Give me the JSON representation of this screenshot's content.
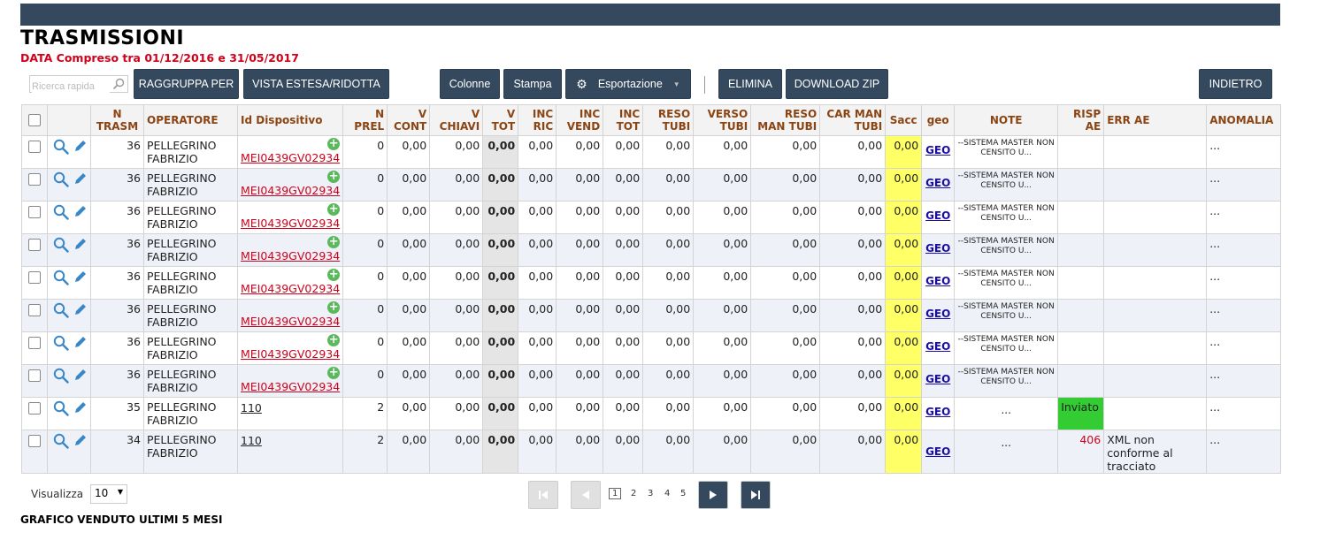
{
  "page": {
    "title": "TRASMISSIONI",
    "subtitle": "DATA Compreso tra 01/12/2016 e 31/05/2017"
  },
  "toolbar": {
    "search_placeholder": "Ricerca rapida",
    "raggruppa": "RAGGRUPPA PER",
    "vista": "VISTA ESTESA/RIDOTTA",
    "colonne": "Colonne",
    "stampa": "Stampa",
    "esportazione": "Esportazione",
    "elimina": "ELIMINA",
    "download": "DOWNLOAD ZIP",
    "indietro": "INDIETRO"
  },
  "table": {
    "headers": [
      "",
      "",
      "N TRASM",
      "OPERATORE",
      "Id Dispositivo",
      "N PREL",
      "V CONT",
      "V CHIAVI",
      "V TOT",
      "INC RIC",
      "INC VEND",
      "INC TOT",
      "RESO TUBI",
      "VERSO TUBI",
      "RESO MAN TUBI",
      "CAR MAN TUBI",
      "Sacc",
      "geo",
      "NOTE",
      "RISP AE",
      "ERR AE",
      "ANOMALIA"
    ],
    "rows": [
      {
        "trasm": "36",
        "operatore": "PELLEGRINO FABRIZIO",
        "dispositivo": "MEI0439GV02934",
        "prel": "0",
        "cont": "0,00",
        "chiavi": "0,00",
        "tot": "0,00",
        "incric": "0,00",
        "incvend": "0,00",
        "inctot": "0,00",
        "reso": "0,00",
        "verso": "0,00",
        "resoman": "0,00",
        "carman": "0,00",
        "sacc": "0,00",
        "geo": "GEO",
        "note": "--SISTEMA MASTER NON CENSITO U...",
        "risp": "",
        "err": "",
        "anomalia": "..."
      },
      {
        "trasm": "36",
        "operatore": "PELLEGRINO FABRIZIO",
        "dispositivo": "MEI0439GV02934",
        "prel": "0",
        "cont": "0,00",
        "chiavi": "0,00",
        "tot": "0,00",
        "incric": "0,00",
        "incvend": "0,00",
        "inctot": "0,00",
        "reso": "0,00",
        "verso": "0,00",
        "resoman": "0,00",
        "carman": "0,00",
        "sacc": "0,00",
        "geo": "GEO",
        "note": "--SISTEMA MASTER NON CENSITO U...",
        "risp": "",
        "err": "",
        "anomalia": "..."
      },
      {
        "trasm": "36",
        "operatore": "PELLEGRINO FABRIZIO",
        "dispositivo": "MEI0439GV02934",
        "prel": "0",
        "cont": "0,00",
        "chiavi": "0,00",
        "tot": "0,00",
        "incric": "0,00",
        "incvend": "0,00",
        "inctot": "0,00",
        "reso": "0,00",
        "verso": "0,00",
        "resoman": "0,00",
        "carman": "0,00",
        "sacc": "0,00",
        "geo": "GEO",
        "note": "--SISTEMA MASTER NON CENSITO U...",
        "risp": "",
        "err": "",
        "anomalia": "..."
      },
      {
        "trasm": "36",
        "operatore": "PELLEGRINO FABRIZIO",
        "dispositivo": "MEI0439GV02934",
        "prel": "0",
        "cont": "0,00",
        "chiavi": "0,00",
        "tot": "0,00",
        "incric": "0,00",
        "incvend": "0,00",
        "inctot": "0,00",
        "reso": "0,00",
        "verso": "0,00",
        "resoman": "0,00",
        "carman": "0,00",
        "sacc": "0,00",
        "geo": "GEO",
        "note": "--SISTEMA MASTER NON CENSITO U...",
        "risp": "",
        "err": "",
        "anomalia": "..."
      },
      {
        "trasm": "36",
        "operatore": "PELLEGRINO FABRIZIO",
        "dispositivo": "MEI0439GV02934",
        "prel": "0",
        "cont": "0,00",
        "chiavi": "0,00",
        "tot": "0,00",
        "incric": "0,00",
        "incvend": "0,00",
        "inctot": "0,00",
        "reso": "0,00",
        "verso": "0,00",
        "resoman": "0,00",
        "carman": "0,00",
        "sacc": "0,00",
        "geo": "GEO",
        "note": "--SISTEMA MASTER NON CENSITO U...",
        "risp": "",
        "err": "",
        "anomalia": "..."
      },
      {
        "trasm": "36",
        "operatore": "PELLEGRINO FABRIZIO",
        "dispositivo": "MEI0439GV02934",
        "prel": "0",
        "cont": "0,00",
        "chiavi": "0,00",
        "tot": "0,00",
        "incric": "0,00",
        "incvend": "0,00",
        "inctot": "0,00",
        "reso": "0,00",
        "verso": "0,00",
        "resoman": "0,00",
        "carman": "0,00",
        "sacc": "0,00",
        "geo": "GEO",
        "note": "--SISTEMA MASTER NON CENSITO U...",
        "risp": "",
        "err": "",
        "anomalia": "..."
      },
      {
        "trasm": "36",
        "operatore": "PELLEGRINO FABRIZIO",
        "dispositivo": "MEI0439GV02934",
        "prel": "0",
        "cont": "0,00",
        "chiavi": "0,00",
        "tot": "0,00",
        "incric": "0,00",
        "incvend": "0,00",
        "inctot": "0,00",
        "reso": "0,00",
        "verso": "0,00",
        "resoman": "0,00",
        "carman": "0,00",
        "sacc": "0,00",
        "geo": "GEO",
        "note": "--SISTEMA MASTER NON CENSITO U...",
        "risp": "",
        "err": "",
        "anomalia": "..."
      },
      {
        "trasm": "36",
        "operatore": "PELLEGRINO FABRIZIO",
        "dispositivo": "MEI0439GV02934",
        "prel": "0",
        "cont": "0,00",
        "chiavi": "0,00",
        "tot": "0,00",
        "incric": "0,00",
        "incvend": "0,00",
        "inctot": "0,00",
        "reso": "0,00",
        "verso": "0,00",
        "resoman": "0,00",
        "carman": "0,00",
        "sacc": "0,00",
        "geo": "GEO",
        "note": "--SISTEMA MASTER NON CENSITO U...",
        "risp": "",
        "err": "",
        "anomalia": "..."
      },
      {
        "trasm": "35",
        "operatore": "PELLEGRINO FABRIZIO",
        "dispositivo": "110",
        "prel": "2",
        "cont": "0,00",
        "chiavi": "0,00",
        "tot": "0,00",
        "incric": "0,00",
        "incvend": "0,00",
        "inctot": "0,00",
        "reso": "0,00",
        "verso": "0,00",
        "resoman": "0,00",
        "carman": "0,00",
        "sacc": "0,00",
        "geo": "GEO",
        "note": "...",
        "risp": "Inviato",
        "err": "",
        "anomalia": "..."
      },
      {
        "trasm": "34",
        "operatore": "PELLEGRINO FABRIZIO",
        "dispositivo": "110",
        "prel": "2",
        "cont": "0,00",
        "chiavi": "0,00",
        "tot": "0,00",
        "incric": "0,00",
        "incvend": "0,00",
        "inctot": "0,00",
        "reso": "0,00",
        "verso": "0,00",
        "resoman": "0,00",
        "carman": "0,00",
        "sacc": "0,00",
        "geo": "GEO",
        "note": "...",
        "risp": "406",
        "err": "XML non conforme al tracciato",
        "anomalia": "..."
      }
    ]
  },
  "pagination": {
    "visualizza_label": "Visualizza",
    "page_size": "10",
    "pages": [
      "1",
      "2",
      "3",
      "4",
      "5"
    ],
    "current": "1"
  },
  "chart_section": {
    "title": "GRAFICO VENDUTO ULTIMI 5 MESI"
  },
  "colors": {
    "navy": "#34495e",
    "header_text": "#8b4513",
    "red": "#d0021b",
    "sacc_yellow": "#ffff66",
    "inviato_green": "#33cc33"
  }
}
